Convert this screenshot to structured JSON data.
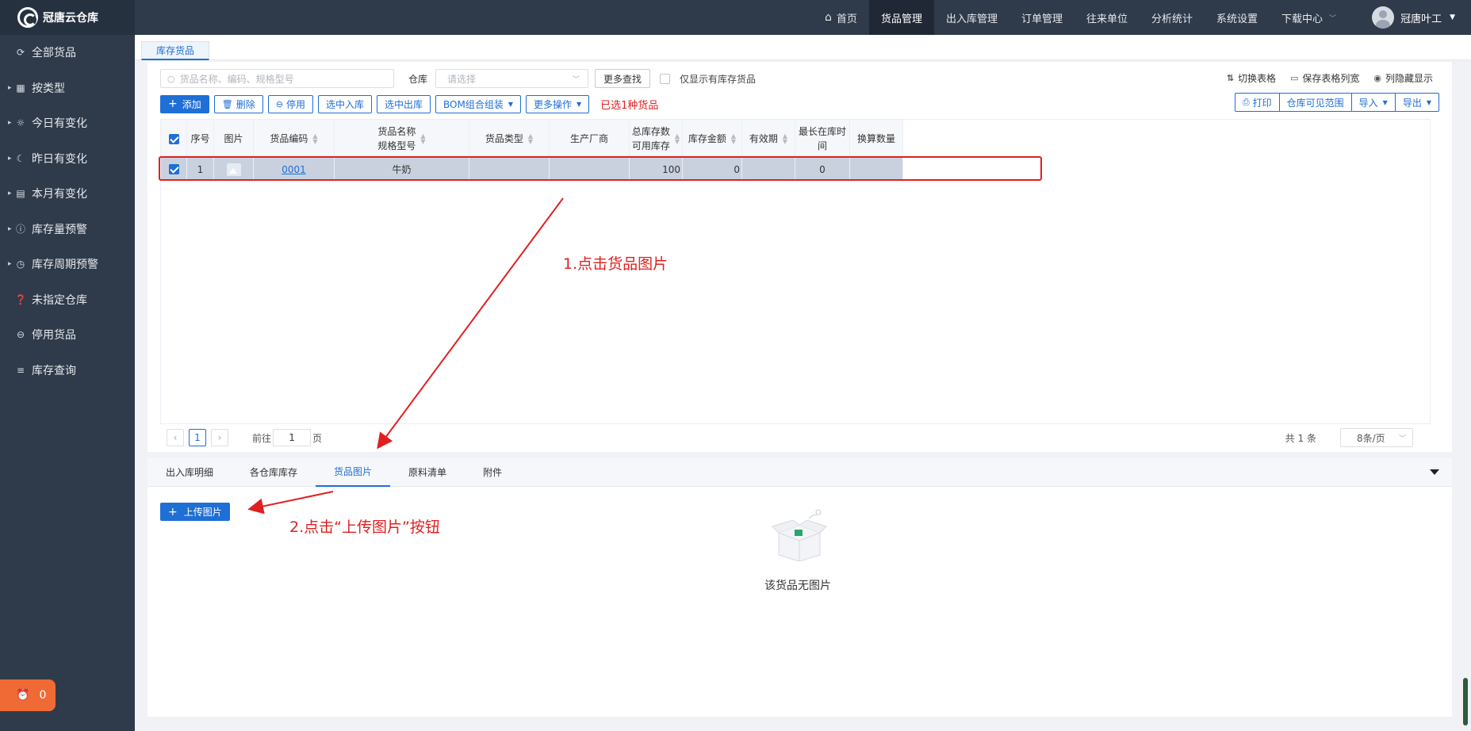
{
  "app": {
    "title": "冠唐云仓库"
  },
  "sidebar": {
    "items": [
      {
        "label": "全部货品",
        "icon": "refresh-icon",
        "caret": false
      },
      {
        "label": "按类型",
        "icon": "grid-icon",
        "caret": true
      },
      {
        "label": "今日有变化",
        "icon": "sun-icon",
        "caret": true
      },
      {
        "label": "昨日有变化",
        "icon": "moon-icon",
        "caret": true
      },
      {
        "label": "本月有变化",
        "icon": "calendar-icon",
        "caret": true
      },
      {
        "label": "库存量预警",
        "icon": "alert-icon",
        "caret": true
      },
      {
        "label": "库存周期预警",
        "icon": "clock-icon",
        "caret": true
      },
      {
        "label": "未指定仓库",
        "icon": "question-icon",
        "caret": false
      },
      {
        "label": "停用货品",
        "icon": "minus-circle-icon",
        "caret": false
      },
      {
        "label": "库存查询",
        "icon": "list-icon",
        "caret": false
      }
    ],
    "alarm_count": "0"
  },
  "topnav": {
    "items": [
      "首页",
      "货品管理",
      "出入库管理",
      "订单管理",
      "往来单位",
      "分析统计",
      "系统设置",
      "下载中心"
    ],
    "active": "货品管理",
    "user": "冠唐叶工"
  },
  "page_tab": "库存货品",
  "toolbar": {
    "search_placeholder": "货品名称、编码、规格型号",
    "warehouse_label": "仓库",
    "warehouse_placeholder": "请选择",
    "more_search": "更多查找",
    "only_stock": "仅显示有库存货品",
    "right_links": [
      "切换表格",
      "保存表格列宽",
      "列隐藏显示"
    ],
    "buttons": [
      "添加",
      "删除",
      "停用",
      "选中入库",
      "选中出库",
      "BOM组合组装",
      "更多操作"
    ],
    "selected_note": "已选1种货品",
    "right_buttons": [
      "打印",
      "仓库可见范围",
      "导入",
      "导出"
    ]
  },
  "table": {
    "columns": [
      {
        "key": "check",
        "label": ""
      },
      {
        "key": "seq",
        "label": "序号"
      },
      {
        "key": "img",
        "label": "图片"
      },
      {
        "key": "code",
        "label": "货品编码"
      },
      {
        "key": "name",
        "label": "货品名称",
        "label2": "规格型号"
      },
      {
        "key": "type",
        "label": "货品类型"
      },
      {
        "key": "maker",
        "label": "生产厂商"
      },
      {
        "key": "qty",
        "label": "总库存数",
        "label2": "可用库存"
      },
      {
        "key": "amount",
        "label": "库存金额"
      },
      {
        "key": "expiry",
        "label": "有效期"
      },
      {
        "key": "longest",
        "label": "最长在库时间"
      },
      {
        "key": "convert",
        "label": "换算数量"
      }
    ],
    "rows": [
      {
        "seq": "1",
        "code": "0001",
        "name": "牛奶",
        "type": "",
        "maker": "",
        "qty": "100",
        "amount": "0",
        "expiry": "",
        "longest": "0",
        "convert": ""
      }
    ]
  },
  "pager": {
    "current": "1",
    "goto_prefix": "前往",
    "goto_value": "1",
    "goto_suffix": "页",
    "total": "共 1 条",
    "page_size": "8条/页"
  },
  "detail": {
    "tabs": [
      "出入库明细",
      "各仓库库存",
      "货品图片",
      "原料清单",
      "附件"
    ],
    "active": "货品图片",
    "upload_button": "上传图片",
    "empty_text": "该货品无图片"
  },
  "annotations": {
    "step1": "1.点击货品图片",
    "step2": "2.点击“上传图片”按钮"
  },
  "colors": {
    "primary": "#1e6fd6",
    "sidebar": "#2f3a4a",
    "highlight": "#e02020",
    "alarm": "#f06a35"
  }
}
